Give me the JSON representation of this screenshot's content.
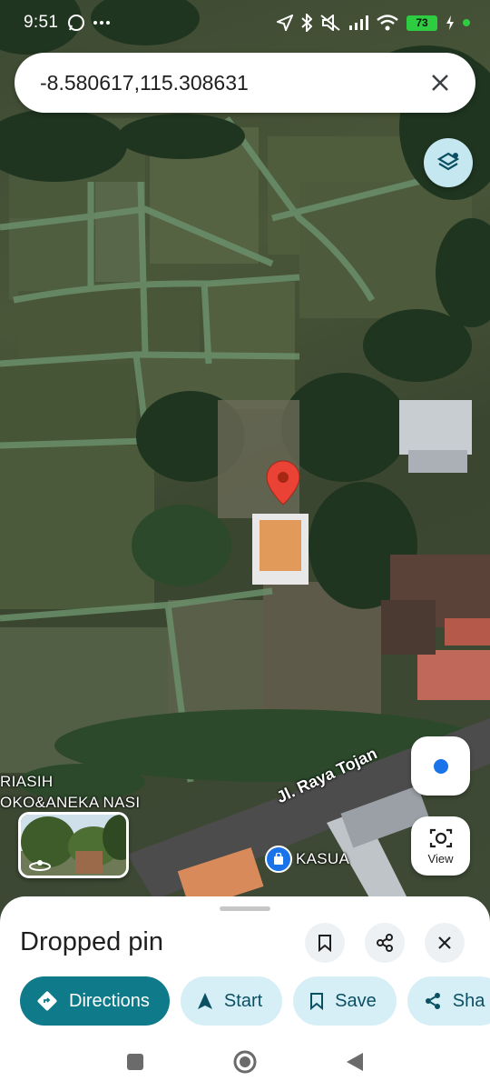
{
  "status_bar": {
    "time": "9:51",
    "battery": "73"
  },
  "search": {
    "value": "-8.580617,115.308631"
  },
  "map": {
    "poi_text_line1": "RIASIH",
    "poi_text_line2": "OKO&ANEKA NASI",
    "road_name": "Jl. Raya Tojan",
    "place_name": "KASUA"
  },
  "view_button": {
    "label": "View"
  },
  "sheet": {
    "title": "Dropped pin",
    "actions": {
      "directions": "Directions",
      "start": "Start",
      "save": "Save",
      "share": "Sha"
    }
  },
  "colors": {
    "primary": "#0e7a8a",
    "chip_bg": "#d6eff6",
    "pin": "#ea4335",
    "location": "#1a73e8"
  }
}
